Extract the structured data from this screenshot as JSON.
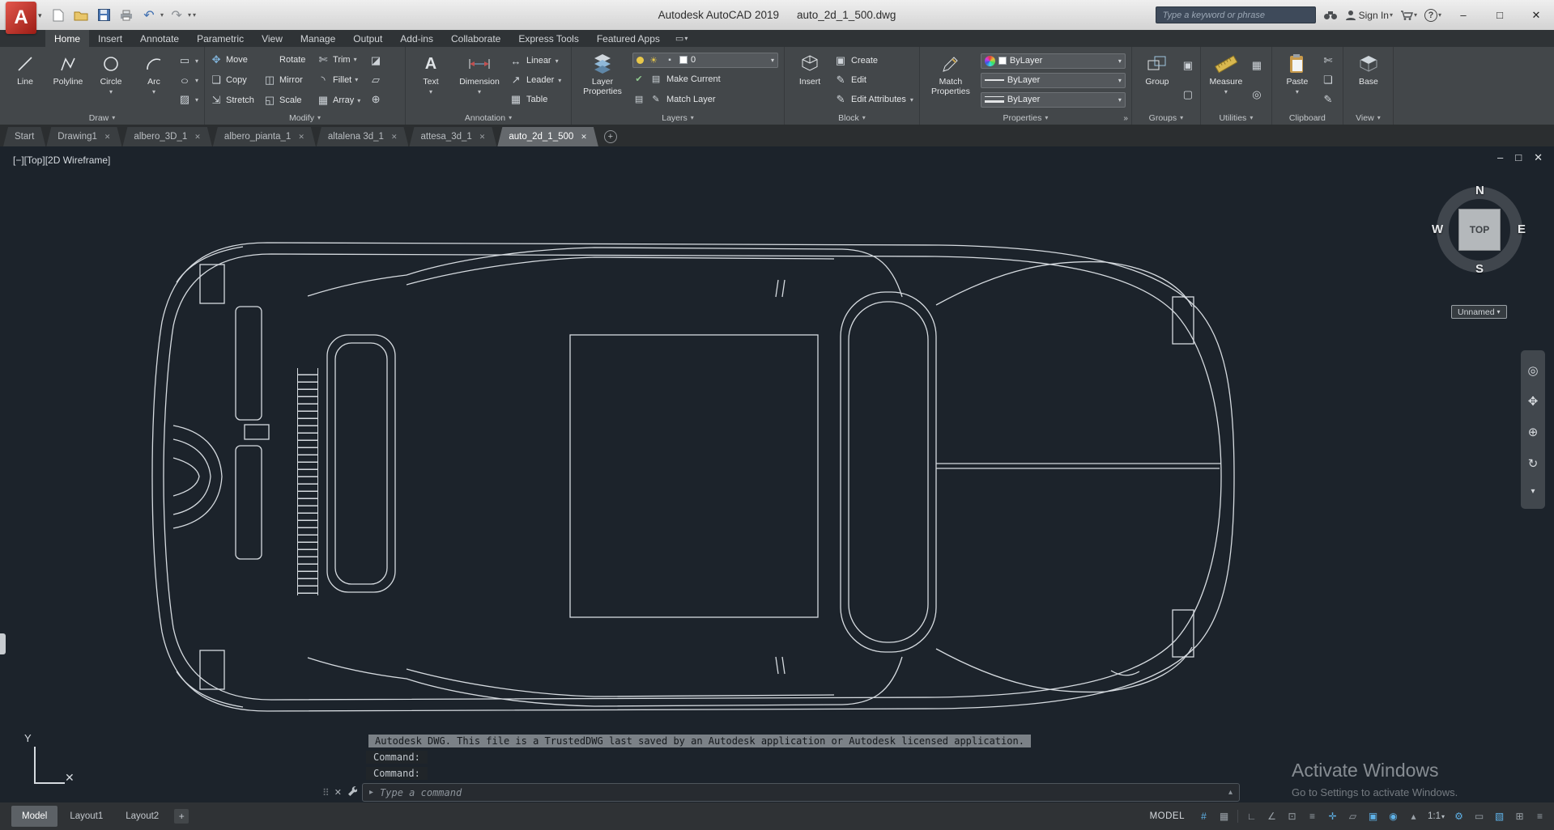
{
  "titlebar": {
    "app_title": "Autodesk AutoCAD 2019",
    "doc_title": "auto_2d_1_500.dwg",
    "search_placeholder": "Type a keyword or phrase",
    "sign_in_label": "Sign In"
  },
  "icons": {
    "caret_down": "▾",
    "caret_up": "▴",
    "minimize": "–",
    "maximize": "□",
    "close": "✕",
    "plus": "+",
    "help": "?",
    "undo": "↶",
    "redo": "↷",
    "panel_box": "▭",
    "expand_right": "»",
    "grip": "⠿"
  },
  "tool_icons": {
    "rectangle": "▭",
    "ellipse": "○",
    "hatch": "▨",
    "move": "✥",
    "rotate": "↻",
    "trim": "✄",
    "copy": "❏",
    "mirror": "◫",
    "fillet": "◝",
    "stretch": "⇲",
    "scale": "◱",
    "array": "▦",
    "erase": "◪",
    "explode": "▱",
    "offset": "⊕",
    "linear": "↔",
    "leader": "↗",
    "table": "▦",
    "create": "▣",
    "edit": "✎",
    "edit_attributes": "✎",
    "cut": "✄",
    "copy_clip": "❏",
    "match": "✎",
    "calculator": "▦",
    "id_point": "◎",
    "group_edit": "▣",
    "ungroup": "▢",
    "bulb": "●",
    "sun": "☀",
    "lock": "▪",
    "check": "✔",
    "layers_row": "▤"
  },
  "ribbon_tabs": {
    "items": [
      "Home",
      "Insert",
      "Annotate",
      "Parametric",
      "View",
      "Manage",
      "Output",
      "Add-ins",
      "Collaborate",
      "Express Tools",
      "Featured Apps"
    ],
    "active": "Home"
  },
  "panels": {
    "draw": {
      "label": "Draw",
      "line": "Line",
      "polyline": "Polyline",
      "circle": "Circle",
      "arc": "Arc"
    },
    "modify": {
      "label": "Modify",
      "move": "Move",
      "rotate": "Rotate",
      "trim": "Trim",
      "copy": "Copy",
      "mirror": "Mirror",
      "fillet": "Fillet",
      "stretch": "Stretch",
      "scale": "Scale",
      "array": "Array"
    },
    "annotation": {
      "label": "Annotation",
      "text": "Text",
      "dimension": "Dimension",
      "linear": "Linear",
      "leader": "Leader",
      "table": "Table"
    },
    "layers": {
      "label": "Layers",
      "layer_properties": "Layer Properties",
      "current_layer": "0",
      "make_current": "Make Current",
      "match_layer": "Match Layer"
    },
    "block": {
      "label": "Block",
      "insert": "Insert",
      "create": "Create",
      "edit": "Edit",
      "edit_attributes": "Edit Attributes"
    },
    "properties": {
      "label": "Properties",
      "match_properties": "Match Properties",
      "color": "ByLayer",
      "linetype": "ByLayer",
      "lineweight": "ByLayer"
    },
    "groups": {
      "label": "Groups",
      "group": "Group"
    },
    "utilities": {
      "label": "Utilities",
      "measure": "Measure"
    },
    "clipboard": {
      "label": "Clipboard",
      "paste": "Paste"
    },
    "view": {
      "label": "View",
      "base": "Base"
    }
  },
  "file_tabs": {
    "items": [
      "Start",
      "Drawing1",
      "albero_3D_1",
      "albero_pianta_1",
      "altalena 3d_1",
      "attesa_3d_1",
      "auto_2d_1_500"
    ],
    "active": "auto_2d_1_500"
  },
  "viewport": {
    "controls_label": "[−][Top][2D Wireframe]",
    "viewcube": {
      "north": "N",
      "south": "S",
      "east": "E",
      "west": "W",
      "face": "TOP"
    },
    "view_name": "Unnamed"
  },
  "navbar": {
    "wheel": "◎",
    "pan": "✥",
    "zoom": "⊕",
    "orbit": "↻",
    "more": "▾"
  },
  "ucs": {
    "y_label": "Y",
    "x_mark": "✕"
  },
  "command": {
    "history": [
      "Autodesk DWG.  This file is a TrustedDWG last saved by an Autodesk application or Autodesk licensed application.",
      "Command:",
      "Command:"
    ],
    "input_placeholder": "Type a command"
  },
  "layout_tabs": {
    "items": [
      "Model",
      "Layout1",
      "Layout2"
    ],
    "active": "Model"
  },
  "statusbar": {
    "space_label": "MODEL",
    "scale": "1:1",
    "icons": {
      "grid": "#",
      "snap": "▦",
      "ortho": "∟",
      "polar": "∠",
      "osnap": "⊡",
      "lineweight": "≡",
      "dyninput": "✛",
      "transparency": "▱",
      "cycling": "▣",
      "annotation": "◉",
      "autoscale": "▴",
      "workspace": "⚙",
      "monitor": "▭",
      "performance": "▧",
      "clean": "⊞",
      "customize": "≡"
    }
  },
  "watermark": {
    "line1": "Activate Windows",
    "line2": "Go to Settings to activate Windows."
  },
  "colors": {
    "canvas_bg": "#1c232b",
    "line": "#d6dbe0",
    "accent_blue": "#5fb2e8",
    "titlebar_red": "#b3241b"
  }
}
